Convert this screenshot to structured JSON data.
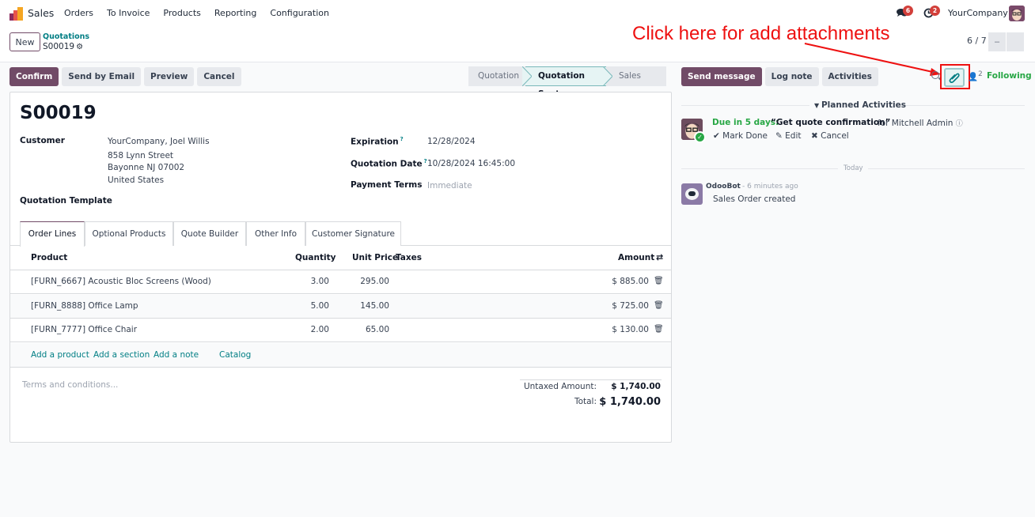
{
  "navbar": {
    "app_name": "Sales",
    "menu": [
      "Orders",
      "To Invoice",
      "Products",
      "Reporting",
      "Configuration"
    ],
    "messages_badge": "6",
    "activities_badge": "2",
    "company": "YourCompany"
  },
  "control_panel": {
    "new_label": "New",
    "breadcrumb_parent": "Quotations",
    "breadcrumb_current": "S00019",
    "pager": "6 / 7",
    "pager_prev": "–",
    "pager_next": ""
  },
  "annotation": {
    "text": "Click here for add attachments",
    "color": "#ee1111"
  },
  "actions": {
    "confirm": "Confirm",
    "send_email": "Send by Email",
    "preview": "Preview",
    "cancel": "Cancel"
  },
  "statusbar": {
    "stages": [
      "Quotation",
      "Quotation Sent",
      "Sales Order"
    ],
    "active": "Quotation Sent"
  },
  "form": {
    "title": "S00019",
    "customer_label": "Customer",
    "customer_name": "YourCompany, Joel Willis",
    "customer_street": "858 Lynn Street",
    "customer_city": "Bayonne NJ 07002",
    "customer_country": "United States",
    "template_label": "Quotation Template",
    "expiration_label": "Expiration",
    "expiration_value": "12/28/2024",
    "quotation_date_label": "Quotation Date",
    "quotation_date_value": "10/28/2024 16:45:00",
    "payment_terms_label": "Payment Terms",
    "payment_terms_value": "Immediate",
    "help_mark": "?"
  },
  "tabs": [
    "Order Lines",
    "Optional Products",
    "Quote Builder",
    "Other Info",
    "Customer Signature"
  ],
  "table": {
    "headers": {
      "product": "Product",
      "quantity": "Quantity",
      "unit_price": "Unit Price",
      "taxes": "Taxes",
      "amount": "Amount"
    },
    "rows": [
      {
        "product": "[FURN_6667] Acoustic Bloc Screens (Wood)",
        "quantity": "3.00",
        "unit_price": "295.00",
        "taxes": "",
        "amount": "$ 885.00"
      },
      {
        "product": "[FURN_8888] Office Lamp",
        "quantity": "5.00",
        "unit_price": "145.00",
        "taxes": "",
        "amount": "$ 725.00"
      },
      {
        "product": "[FURN_7777] Office Chair",
        "quantity": "2.00",
        "unit_price": "65.00",
        "taxes": "",
        "amount": "$ 130.00"
      }
    ],
    "add_links": {
      "product": "Add a product",
      "section": "Add a section",
      "note": "Add a note",
      "catalog": "Catalog"
    }
  },
  "footer": {
    "terms_placeholder": "Terms and conditions...",
    "untaxed_label": "Untaxed Amount:",
    "untaxed_value": "$ 1,740.00",
    "total_label": "Total:",
    "total_value": "$ 1,740.00"
  },
  "chatter": {
    "send_message": "Send message",
    "log_note": "Log note",
    "activities": "Activities",
    "followers_count": "2",
    "following": "Following",
    "planned_activities": "Planned Activities",
    "activity": {
      "due": "Due in 5 days:",
      "summary": "“Get quote confirmation”",
      "assignee": "for Mitchell Admin",
      "mark_done": "Mark Done",
      "edit": "Edit",
      "cancel": "Cancel"
    },
    "date_separator": "Today",
    "message": {
      "author": "OdooBot",
      "time": "- 6 minutes ago",
      "body": "Sales Order created"
    }
  },
  "colors": {
    "brand": "#714b67",
    "link": "#017e84",
    "success": "#28a745",
    "badge": "#d23f3a"
  }
}
